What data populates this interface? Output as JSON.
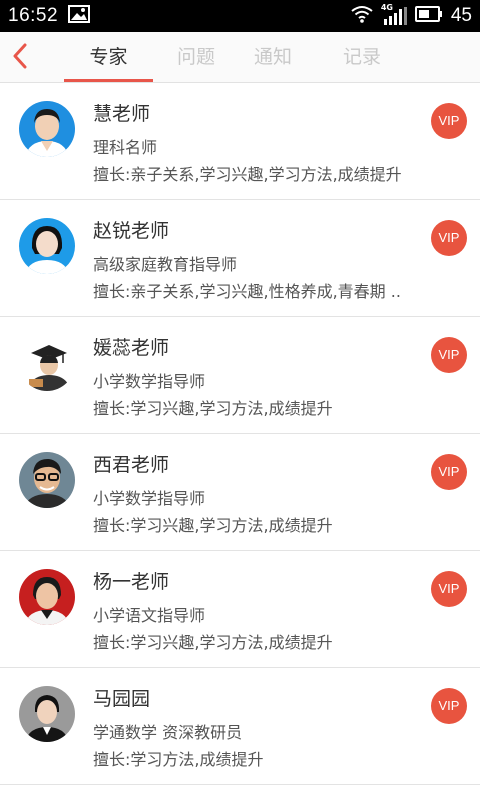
{
  "statusbar": {
    "time": "16:52",
    "network": "4G",
    "battery": "45"
  },
  "tabs": [
    {
      "label": "专家",
      "active": true
    },
    {
      "label": "问题",
      "active": false
    },
    {
      "label": "通知",
      "active": false
    },
    {
      "label": "记录",
      "active": false
    }
  ],
  "experts": [
    {
      "name": "慧老师",
      "title": "理科名师",
      "skills": "擅长:亲子关系,学习兴趣,学习方法,成绩提升",
      "badge": "VIP"
    },
    {
      "name": "赵锐老师",
      "title": "高级家庭教育指导师",
      "skills": "擅长:亲子关系,学习兴趣,性格养成,青春期 ..",
      "badge": "VIP"
    },
    {
      "name": "媛蕊老师",
      "title": "小学数学指导师",
      "skills": "擅长:学习兴趣,学习方法,成绩提升",
      "badge": "VIP"
    },
    {
      "name": "西君老师",
      "title": "小学数学指导师",
      "skills": "擅长:学习兴趣,学习方法,成绩提升",
      "badge": "VIP"
    },
    {
      "name": "杨一老师",
      "title": "小学语文指导师",
      "skills": "擅长:学习兴趣,学习方法,成绩提升",
      "badge": "VIP"
    },
    {
      "name": "马园园",
      "title": "学通数学 资深教研员",
      "skills": "擅长:学习方法,成绩提升",
      "badge": "VIP"
    }
  ],
  "colors": {
    "accent": "#e8564a",
    "vip": "#e8543f"
  }
}
